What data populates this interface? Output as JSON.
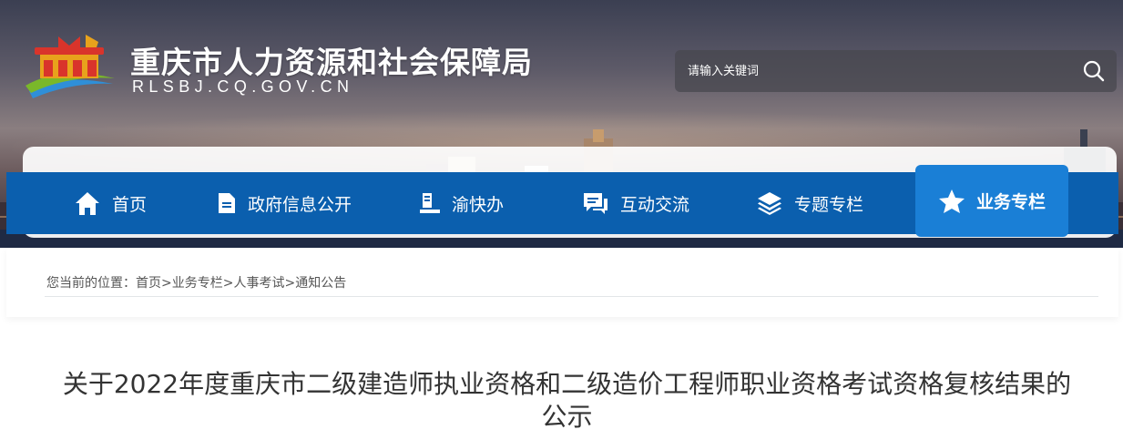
{
  "header": {
    "site_title": "重庆市人力资源和社会保障局",
    "site_domain": "RLSBJ.CQ.GOV.CN",
    "logo_icon": "temple-gate-logo-icon"
  },
  "search": {
    "placeholder": "请输入关键词",
    "button_icon": "search-icon"
  },
  "nav": {
    "items": [
      {
        "label": "首页",
        "icon": "home-icon"
      },
      {
        "label": "政府信息公开",
        "icon": "document-icon"
      },
      {
        "label": "渝快办",
        "icon": "desk-user-icon"
      },
      {
        "label": "互动交流",
        "icon": "chat-icon"
      },
      {
        "label": "专题专栏",
        "icon": "layers-icon"
      },
      {
        "label": "业务专栏",
        "icon": "star-icon",
        "active": true
      }
    ],
    "colors": {
      "bar": "#0b5fae",
      "active": "#1a7fd6"
    }
  },
  "breadcrumb": {
    "prefix": "您当前的位置：",
    "items": [
      "首页",
      "业务专栏",
      "人事考试",
      "通知公告"
    ],
    "separator": ">"
  },
  "article": {
    "title": "关于2022年度重庆市二级建造师执业资格和二级造价工程师职业资格考试资格复核结果的公示"
  }
}
